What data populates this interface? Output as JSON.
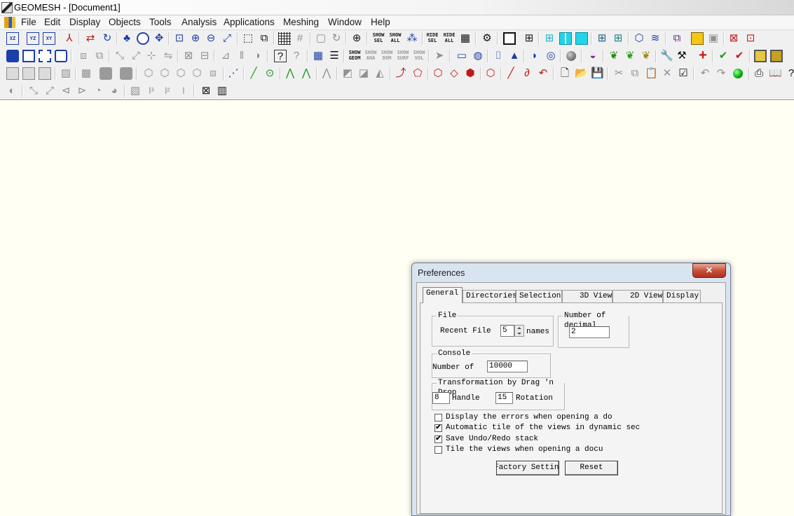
{
  "window": {
    "title": "GEOMESH - [Document1]"
  },
  "menubar": {
    "items": [
      "File",
      "Edit",
      "Display",
      "Objects",
      "Tools",
      "Analysis",
      "Applications",
      "Meshing",
      "Window",
      "Help"
    ]
  },
  "toolbar1": {
    "view_xz": "XZ",
    "view_yz": "YZ",
    "view_xy": "XY",
    "show_sel": "SHOW SEL",
    "show_all": "SHOW ALL",
    "hide_sel": "HIDE SEL",
    "hide_all": "HIDE ALL"
  },
  "toolbar2": {
    "show_geom": "SHOW GEOM",
    "show_ana": "SHOW ANA",
    "show_dom": "SHOW DOM",
    "show_surf": "SHOW SURF",
    "show_vol": "SHOW VOL"
  },
  "toolbar4": {
    "l3": "l³",
    "l2": "l²",
    "l": "l"
  },
  "preferences": {
    "title": "Preferences",
    "close_glyph": "✕",
    "tabs": [
      "General",
      "Directories",
      "Selection",
      "3D View",
      "2D View",
      "Display"
    ],
    "active_tab": "General",
    "file_group": {
      "legend": "File",
      "recent_file_label": "Recent File",
      "recent_file_value": "5",
      "names_label": "names"
    },
    "decimal_group": {
      "legend": "Number of decimal",
      "value": "2"
    },
    "console_group": {
      "legend": "Console",
      "number_label": "Number of",
      "number_value": "10000"
    },
    "transform_group": {
      "legend": "Transformation by Drag 'n Drop",
      "handle_value": "8",
      "handle_label": "Handle",
      "rotation_value": "15",
      "rotation_label": "Rotation"
    },
    "checkboxes": [
      {
        "label": "Display the errors when opening a do",
        "checked": false
      },
      {
        "label": "Automatic tile of the views in dynamic sec",
        "checked": true
      },
      {
        "label": "Save Undo/Redo stack",
        "checked": true
      },
      {
        "label": "Tile the views when opening a docu",
        "checked": false
      }
    ],
    "check_mark": "✔",
    "factory_button": "Factory Settings",
    "reset_button": "Reset"
  }
}
